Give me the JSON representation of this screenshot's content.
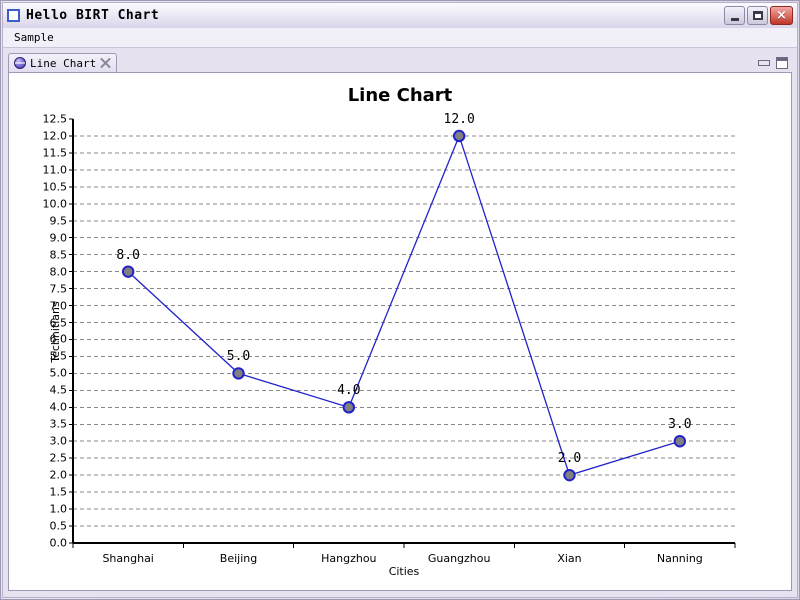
{
  "window": {
    "title": "Hello BIRT Chart",
    "icon": "window-icon",
    "buttons": {
      "minimize": "minimize-icon",
      "maximize": "maximize-icon",
      "close": "×"
    }
  },
  "menubar": {
    "items": [
      {
        "label": "Sample"
      }
    ]
  },
  "tabs": [
    {
      "label": "Line Chart",
      "icon": "globe-icon",
      "close_icon": "close-icon",
      "active": true
    }
  ],
  "view_controls": {
    "minimize": "view-minimize-icon",
    "maximize": "view-maximize-icon"
  },
  "colors": {
    "line": "#2222cc",
    "marker_fill": "#808080",
    "marker_stroke": "#2222cc",
    "gridline": "#888888",
    "axis": "#000000",
    "chart_background": "#ffffff",
    "window_chrome": "#e6e2f0",
    "close_button": "#c33426"
  },
  "chart_data": {
    "type": "line",
    "title": "Line Chart",
    "xlabel": "Cities",
    "ylabel": "Technitians",
    "categories": [
      "Shanghai",
      "Beijing",
      "Hangzhou",
      "Guangzhou",
      "Xian",
      "Nanning"
    ],
    "values": [
      8.0,
      5.0,
      4.0,
      12.0,
      2.0,
      3.0
    ],
    "point_labels": [
      "8.0",
      "5.0",
      "4.0",
      "12.0",
      "2.0",
      "3.0"
    ],
    "ylim": [
      0.0,
      12.5
    ],
    "ytick_step": 0.5,
    "yticks": [
      "0.0",
      "0.5",
      "1.0",
      "1.5",
      "2.0",
      "2.5",
      "3.0",
      "3.5",
      "4.0",
      "4.5",
      "5.0",
      "5.5",
      "6.0",
      "6.5",
      "7.0",
      "7.5",
      "8.0",
      "8.5",
      "9.0",
      "9.5",
      "10.0",
      "10.5",
      "11.0",
      "11.5",
      "12.0",
      "12.5"
    ],
    "grid": true,
    "grid_style": "dashed-horizontal",
    "legend": false,
    "markers": "circle",
    "series": [
      {
        "name": "Technitians",
        "values": [
          8.0,
          5.0,
          4.0,
          12.0,
          2.0,
          3.0
        ]
      }
    ]
  }
}
